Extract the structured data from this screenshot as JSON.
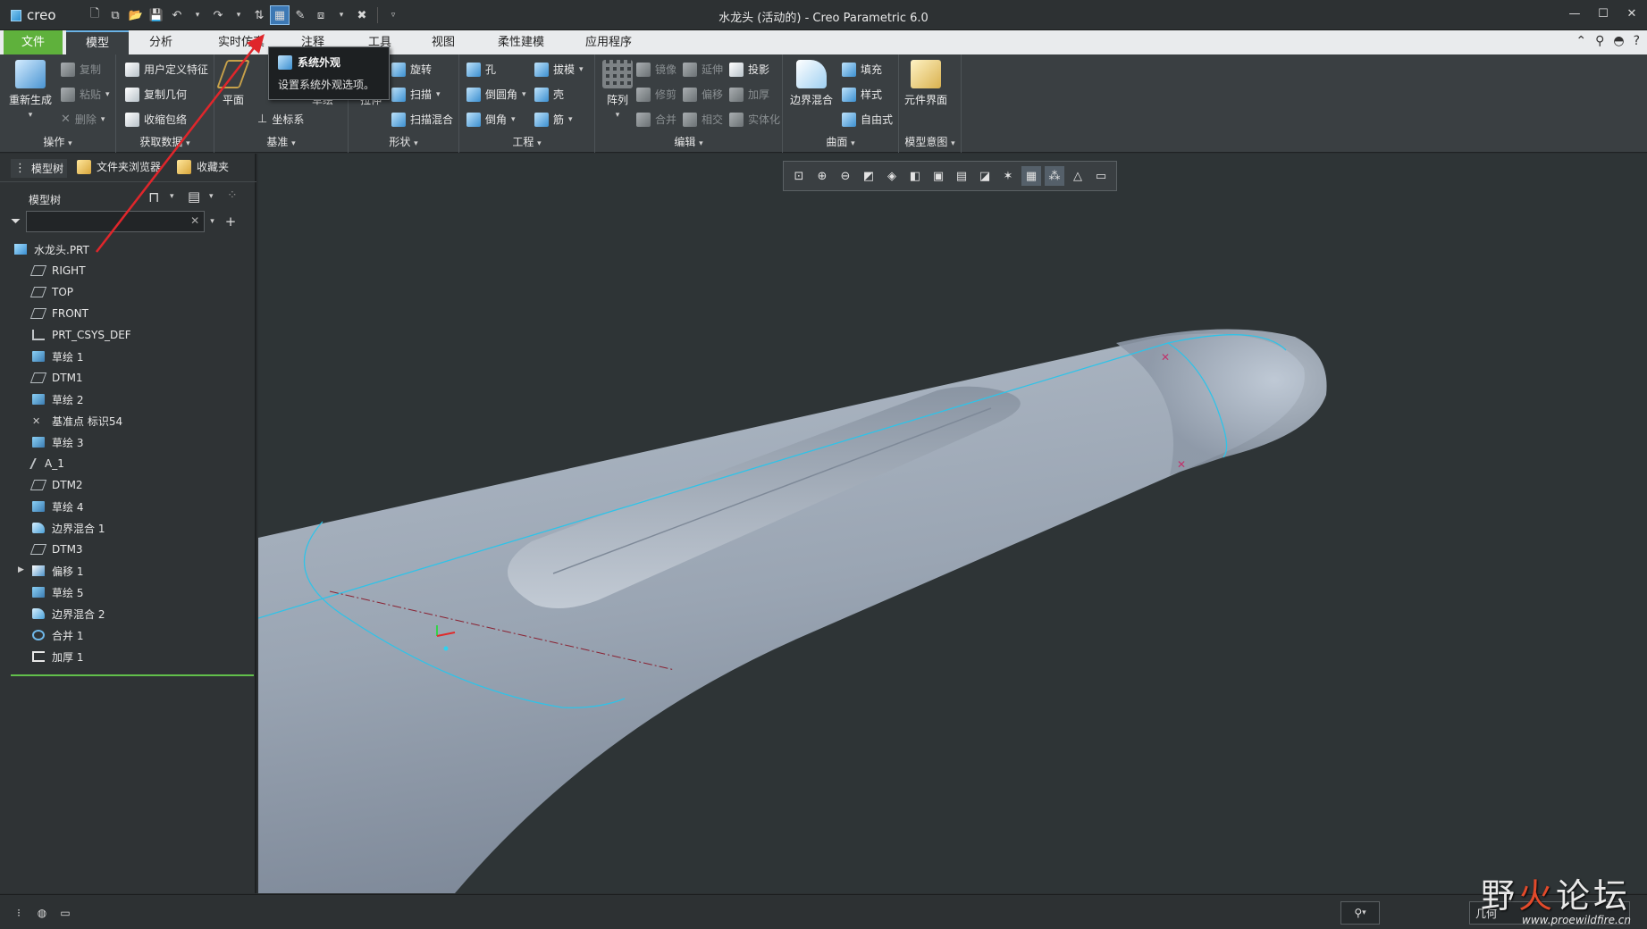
{
  "app": {
    "logo_text": "creo",
    "window_title": "水龙头 (活动的) - Creo Parametric 6.0"
  },
  "tabs": [
    {
      "label": "文件"
    },
    {
      "label": "模型"
    },
    {
      "label": "分析"
    },
    {
      "label": "实时仿真"
    },
    {
      "label": "注释"
    },
    {
      "label": "工具"
    },
    {
      "label": "视图"
    },
    {
      "label": "柔性建模"
    },
    {
      "label": "应用程序"
    }
  ],
  "tooltip": {
    "title": "系统外观",
    "description": "设置系统外观选项。"
  },
  "ribbon": {
    "operations": {
      "label": "操作",
      "regenerate": "重新生成",
      "copy": "复制",
      "paste": "粘贴",
      "delete": "删除"
    },
    "get_data": {
      "label": "获取数据",
      "udf": "用户定义特征",
      "copy_geom": "复制几何",
      "shrinkwrap": "收缩包络"
    },
    "datum": {
      "label": "基准",
      "plane": "平面",
      "csys": "坐标系",
      "sketch": "草绘"
    },
    "shapes": {
      "label": "形状",
      "extrude": "拉伸",
      "revolve": "旋转",
      "sweep": "扫描",
      "swept_blend": "扫描混合"
    },
    "engineering": {
      "label": "工程",
      "hole": "孔",
      "round": "倒圆角",
      "chamfer": "倒角",
      "draft": "拔模",
      "shell": "壳",
      "rib": "筋"
    },
    "editing": {
      "label": "编辑",
      "pattern": "阵列",
      "mirror": "镜像",
      "trim": "修剪",
      "merge": "合并",
      "extend": "延伸",
      "offset": "偏移",
      "intersect": "相交",
      "project": "投影",
      "thicken": "加厚",
      "solidify": "实体化"
    },
    "surfaces": {
      "label": "曲面",
      "boundary_blend": "边界混合",
      "fill": "填充",
      "style": "样式",
      "freestyle": "自由式"
    },
    "model_intent": {
      "label": "模型意图",
      "component_interface": "元件界面"
    }
  },
  "left_panel": {
    "tabs": [
      {
        "label": "模型树"
      },
      {
        "label": "文件夹浏览器"
      },
      {
        "label": "收藏夹"
      }
    ],
    "tree_title": "模型树",
    "search_value": "",
    "tree": [
      {
        "label": "水龙头.PRT",
        "type": "part"
      },
      {
        "label": "RIGHT",
        "type": "plane"
      },
      {
        "label": "TOP",
        "type": "plane"
      },
      {
        "label": "FRONT",
        "type": "plane"
      },
      {
        "label": "PRT_CSYS_DEF",
        "type": "csys"
      },
      {
        "label": "草绘 1",
        "type": "sketch"
      },
      {
        "label": "DTM1",
        "type": "plane"
      },
      {
        "label": "草绘 2",
        "type": "sketch"
      },
      {
        "label": "基准点 标识54",
        "type": "point"
      },
      {
        "label": "草绘 3",
        "type": "sketch"
      },
      {
        "label": "A_1",
        "type": "axis"
      },
      {
        "label": "DTM2",
        "type": "plane"
      },
      {
        "label": "草绘 4",
        "type": "sketch"
      },
      {
        "label": "边界混合 1",
        "type": "surf"
      },
      {
        "label": "DTM3",
        "type": "plane"
      },
      {
        "label": "偏移 1",
        "type": "offset"
      },
      {
        "label": "草绘 5",
        "type": "sketch"
      },
      {
        "label": "边界混合 2",
        "type": "surf"
      },
      {
        "label": "合并 1",
        "type": "merge"
      },
      {
        "label": "加厚 1",
        "type": "thick"
      }
    ]
  },
  "status": {
    "filter_value": "几何"
  },
  "watermark": {
    "line1_a": "野",
    "line1_fire": "火",
    "line1_b": "论坛",
    "line2": "www.proewildfire.cn"
  },
  "colors": {
    "file_tab": "#5fb13c",
    "accent_blue": "#6bb3e6",
    "model_surface": "#a3adba",
    "edge_cyan": "#2fc3e8",
    "tree_end": "#62c04b"
  }
}
